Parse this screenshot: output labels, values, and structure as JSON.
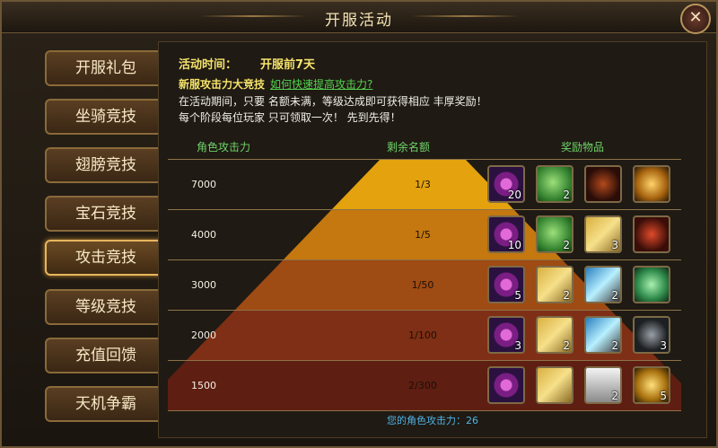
{
  "window": {
    "title": "开服活动",
    "close_label": "✕"
  },
  "sidebar": {
    "tabs": [
      {
        "label": "开服礼包"
      },
      {
        "label": "坐骑竞技"
      },
      {
        "label": "翅膀竞技"
      },
      {
        "label": "宝石竞技"
      },
      {
        "label": "攻击竞技",
        "active": true
      },
      {
        "label": "等级竞技"
      },
      {
        "label": "充值回馈"
      },
      {
        "label": "天机争霸"
      }
    ]
  },
  "content": {
    "time_label": "活动时间：",
    "time_value": "开服前7天",
    "event_title": "新服攻击力大竞技",
    "event_link": "如何快速提高攻击力?",
    "desc1": "在活动期间，只要 名额未满，等级达成即可获得相应 丰厚奖励！",
    "desc2": "每个阶段每位玩家 只可领取一次！ 先到先得！",
    "table": {
      "headers": {
        "attack": "角色攻击力",
        "remaining": "剩余名额",
        "rewards": "奖励物品"
      },
      "rows": [
        {
          "attack": "7000",
          "remaining": "1/3",
          "fill": "#e3a20e",
          "items": [
            {
              "icon": "purple-gem-icon",
              "count": "20"
            },
            {
              "icon": "green-herb-icon",
              "count": "2"
            },
            {
              "icon": "dark-wing-icon",
              "count": ""
            },
            {
              "icon": "golden-wing-icon",
              "count": ""
            }
          ]
        },
        {
          "attack": "4000",
          "remaining": "1/5",
          "fill": "#c4780f",
          "items": [
            {
              "icon": "purple-gem-icon",
              "count": "10"
            },
            {
              "icon": "green-herb-icon",
              "count": "2"
            },
            {
              "icon": "golden-shovel-icon",
              "count": "3"
            },
            {
              "icon": "red-wing-icon",
              "count": ""
            }
          ]
        },
        {
          "attack": "3000",
          "remaining": "1/50",
          "fill": "#9e4b14",
          "items": [
            {
              "icon": "purple-gem-icon",
              "count": "5"
            },
            {
              "icon": "golden-shovel-icon",
              "count": "2"
            },
            {
              "icon": "blue-shovel-icon",
              "count": "2"
            },
            {
              "icon": "green-mount-icon",
              "count": ""
            }
          ]
        },
        {
          "attack": "2000",
          "remaining": "1/100",
          "fill": "#7e2f15",
          "items": [
            {
              "icon": "purple-gem-icon",
              "count": "3"
            },
            {
              "icon": "golden-shovel-icon",
              "count": "2"
            },
            {
              "icon": "blue-shovel-icon",
              "count": "2"
            },
            {
              "icon": "dark-horse-icon",
              "count": "3"
            }
          ]
        },
        {
          "attack": "1500",
          "remaining": "2/300",
          "fill": "#5e1e12",
          "items": [
            {
              "icon": "purple-gem-icon",
              "count": ""
            },
            {
              "icon": "golden-shovel-icon",
              "count": ""
            },
            {
              "icon": "silver-ingot-icon",
              "count": "2"
            },
            {
              "icon": "gold-ingot-icon",
              "count": "5"
            }
          ]
        }
      ]
    },
    "footer": "您的角色攻击力：26"
  }
}
